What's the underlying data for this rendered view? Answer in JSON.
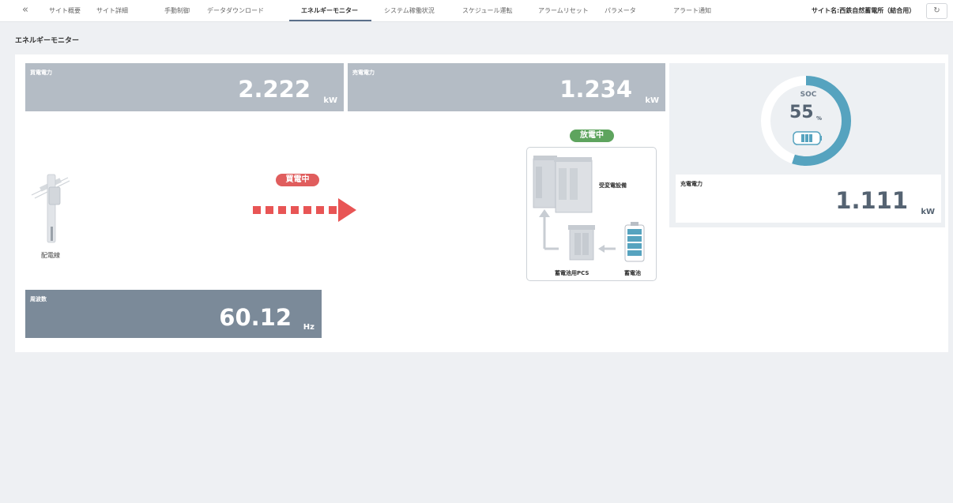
{
  "nav": {
    "back_icon": "double-chevron-left-icon",
    "tabs": [
      "サイト概要",
      "サイト詳細",
      "手動制御",
      "データダウンロード",
      "エネルギーモニター",
      "システム稼働状況",
      "スケジュール運転",
      "アラームリセット",
      "パラメータ",
      "アラート通知"
    ],
    "active_tab": "エネルギーモニター",
    "site_name": "サイト名:西鉄自然蓄電所（結合用）",
    "refresh_icon": "refresh-icon"
  },
  "page": {
    "title": "エネルギーモニター"
  },
  "buy_power": {
    "label": "買電電力",
    "value": "2.222",
    "unit": "kW"
  },
  "sell_power": {
    "label": "売電電力",
    "value": "1.234",
    "unit": "kW"
  },
  "frequency": {
    "label": "周波数",
    "value": "60.12",
    "unit": "Hz"
  },
  "soc": {
    "label": "SOC",
    "value": "55",
    "unit": "%",
    "fraction": 0.55
  },
  "charge_power": {
    "label": "充電電力",
    "value": "1.111",
    "unit": "kW"
  },
  "grid": {
    "label": "配電線"
  },
  "flow": {
    "buy_status": "買電中",
    "discharge_status": "放電中"
  },
  "equipment": {
    "substation": "受変電設備",
    "pcs": "蓄電池用PCS",
    "battery": "蓄電池"
  },
  "colors": {
    "soc_ring": "#56a3bf",
    "buy_arrow": "#e85555",
    "discharge_badge": "#5ea45e",
    "freq_card": "#7b8a99",
    "card": "#b4bcc5"
  }
}
